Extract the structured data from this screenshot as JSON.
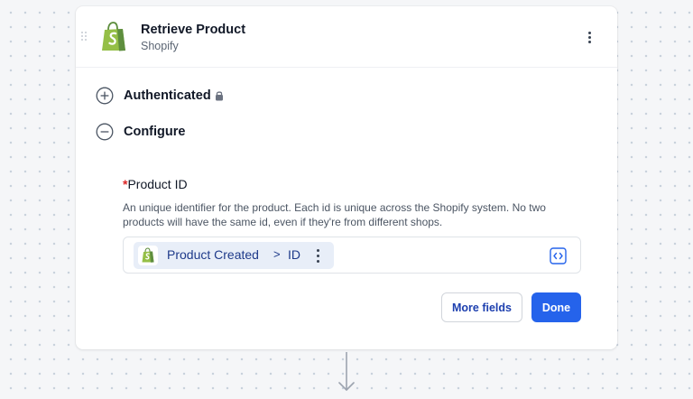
{
  "step": {
    "title": "Retrieve Product",
    "app_name": "Shopify",
    "app_icon": "shopify-bag-icon",
    "brand_color": "#95bf47"
  },
  "sections": {
    "authenticated": {
      "label": "Authenticated",
      "state": "collapsed",
      "locked": true
    },
    "configure": {
      "label": "Configure",
      "state": "expanded"
    }
  },
  "field": {
    "required_marker": "*",
    "label": "Product ID",
    "description": "An unique identifier for the product. Each id is unique across the Shopify system. No two products will have the same id, even if they're from different shops.",
    "token": {
      "source": "Product Created",
      "separator": ">",
      "field": "ID"
    }
  },
  "actions": {
    "more_fields": "More fields",
    "done": "Done"
  },
  "colors": {
    "primary": "#2563eb",
    "token_bg": "#e8eef8",
    "token_text": "#1e3a8a",
    "required": "#dc2626"
  }
}
